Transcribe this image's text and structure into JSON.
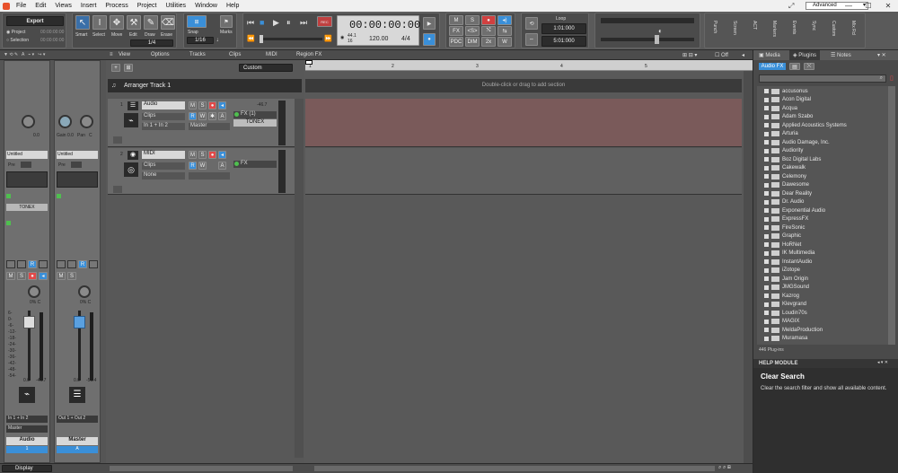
{
  "menu": [
    "File",
    "Edit",
    "Views",
    "Insert",
    "Process",
    "Project",
    "Utilities",
    "Window",
    "Help"
  ],
  "workspace": "Advanced",
  "export": {
    "label": "Export",
    "project_label": "Project",
    "project_time": "00:00:00:00",
    "selection_label": "Selection",
    "selection_time": "00:00:00:00"
  },
  "tools": [
    "Smart",
    "Select",
    "Move",
    "Edit",
    "Draw",
    "Erase"
  ],
  "snap": {
    "label": "Snap",
    "value": "1/4",
    "value2": "1/16",
    "marks": "Marks"
  },
  "transport": {
    "time": "00:00:00:00",
    "sample_rate": "44.1",
    "bit_depth": "16",
    "tempo": "120.00",
    "meter": "4/4"
  },
  "mixbuttons": {
    "m": "M",
    "s": "S",
    "fx": "FX",
    "sends": "<S>",
    "pdc": "PDC",
    "dim": "DIM",
    "x2": "2x",
    "w": "W"
  },
  "loop": {
    "label": "Loop",
    "start": "1:01:000",
    "end": "5:01:000"
  },
  "side_tabs": [
    "Punch",
    "Screen",
    "ACT",
    "Markers",
    "Events",
    "Sync",
    "Custom",
    "Mix Rcl"
  ],
  "views_menu": [
    "View",
    "Options",
    "Tracks",
    "Clips",
    "MIDI",
    "Region FX"
  ],
  "custom_label": "Custom",
  "snap_off": "Off",
  "arranger": {
    "title": "Arranger Track 1",
    "hint": "Double-click or drag to add section"
  },
  "ruler": [
    "1",
    "2",
    "3",
    "4",
    "5"
  ],
  "track1": {
    "num": "1",
    "name": "Audio",
    "mode": "Clips",
    "input": "In 1 + In 2",
    "output": "Master",
    "vol": "-46.7",
    "fx": "FX (1)",
    "plugin": "TONEX",
    "m": "M",
    "s": "S",
    "r": "R",
    "w": "W",
    "a": "A"
  },
  "track2": {
    "num": "2",
    "name": "MIDI",
    "mode": "Clips",
    "input": "None",
    "fx": "FX",
    "m": "M",
    "s": "S",
    "r": "R",
    "w": "W",
    "a": "A"
  },
  "strip_audio": {
    "gain_val": "0.0",
    "preset": "Untitled",
    "pre": "Pre",
    "plugin": "TONEX",
    "pan": "0% C",
    "vol": "0.0",
    "peak": "-46.7",
    "input": "In 1 + In 2",
    "output": "Master",
    "name": "Audio",
    "num": "1"
  },
  "strip_master": {
    "gain": "Gain",
    "gain_val": "0.0",
    "pan_label": "Pan",
    "pan_val": "C",
    "preset": "Untitled",
    "pre": "Pre",
    "pan": "0% C",
    "vol": "0.0",
    "peak": "-51.4",
    "output": "Out 1 + Out 2",
    "name": "Master",
    "num": "A"
  },
  "meter_scale": [
    "6-",
    "0-",
    "-6-",
    "-12-",
    "-18-",
    "-24-",
    "-30-",
    "-36-",
    "-42-",
    "-48-",
    "-54-"
  ],
  "console_footer": "Display",
  "browser": {
    "tabs": [
      "Media",
      "Plugins",
      "Notes"
    ],
    "filter": "Audio FX",
    "folders": [
      "accusonus",
      "Acon Digital",
      "Acqua",
      "Adam Szabo",
      "Applied Acoustics Systems",
      "Arturia",
      "Audio Damage, Inc.",
      "Audiority",
      "Boz Digital Labs",
      "Cakewalk",
      "Celemony",
      "Dawesome",
      "Dear Reality",
      "Dr. Audio",
      "Exponential Audio",
      "ExpressFX",
      "FireSonic",
      "Graphic",
      "HoRNet",
      "IK Multimedia",
      "InstantAudio",
      "iZotope",
      "Jam Origin",
      "JMGSound",
      "Kazrog",
      "Klevgrand",
      "Loudin70s",
      "MAGIX",
      "MeldaProduction",
      "Muramasa"
    ],
    "count": "446 Plug-ins",
    "help_title": "HELP MODULE",
    "help_heading": "Clear Search",
    "help_text": "Clear the search filter and show all available content."
  },
  "colors": {
    "accent_blue": "#3a8fd8",
    "record_red": "#e04848",
    "clip_rose": "#7a5a5a",
    "active_green": "#4fbf4f"
  }
}
